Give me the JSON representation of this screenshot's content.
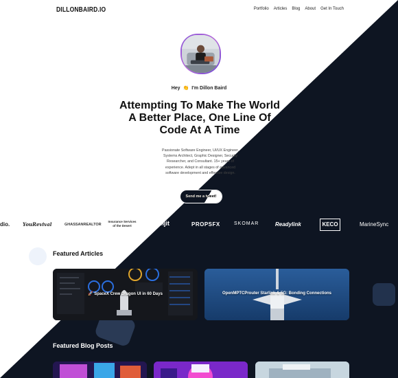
{
  "nav": {
    "logo": "DILLONBAIRD.IO",
    "links": [
      "Portfolio",
      "Articles",
      "Blog",
      "About",
      "Get In Touch"
    ]
  },
  "hero": {
    "greeting_prefix": "Hey",
    "greeting_emoji": "👏",
    "greeting_name": "I'm Dillon Baird",
    "headline": [
      "Attempting To Make The World",
      "A Better Place, One Line Of",
      "Code At A Time"
    ],
    "subtext": [
      "Passionate Software Engineer, UI/UX Engineer,",
      "Systems Architect, Graphic Designer, Security",
      "Researcher, and Consultant. 15+ years of",
      "experience. Adept in all stages of advanced",
      "software development and effective design."
    ],
    "cta_label": "Send me a tweet!"
  },
  "client_logos": [
    "dio.",
    "YouRevival",
    "GHASSANREALTOR",
    "Insurance Services of the Desert",
    "abijit",
    "PROPSFX",
    "SKOMAR",
    "Readylink",
    "KECO",
    "MarineSync"
  ],
  "featured_articles": {
    "title": "Featured Articles",
    "cards": [
      {
        "title": "🚀 SpaceX Crew Dragon UI in 60 Days"
      },
      {
        "title": "OpenMPTCProuter Starlink & 5G: Bonding Connections"
      }
    ]
  },
  "featured_blog": {
    "title": "Featured Blog Posts"
  },
  "colors": {
    "dark": "#0e1522",
    "light": "#ffffff",
    "avatar_ring": "#8a57d8",
    "article_card_2": "#1f4a80"
  }
}
